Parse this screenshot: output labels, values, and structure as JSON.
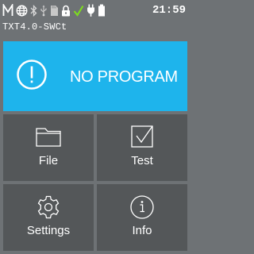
{
  "status_bar": {
    "icons": [
      "motor-m-icon",
      "globe-icon",
      "bluetooth-icon",
      "usb-icon",
      "sd-card-icon",
      "lock-icon",
      "check-icon",
      "power-plug-icon",
      "battery-icon"
    ],
    "time": "21:59",
    "check_color": "#7ddc1f"
  },
  "device": {
    "name": "TXT4.0-SWCt"
  },
  "program_banner": {
    "text": "NO PROGRAM",
    "color": "#1eb4ec"
  },
  "tiles": {
    "file": {
      "label": "File",
      "icon": "folder-icon"
    },
    "test": {
      "label": "Test",
      "icon": "checkbox-icon"
    },
    "settings": {
      "label": "Settings",
      "icon": "gear-icon"
    },
    "info": {
      "label": "Info",
      "icon": "info-icon"
    }
  },
  "colors": {
    "background": "#6e7275",
    "tile": "#545759"
  }
}
